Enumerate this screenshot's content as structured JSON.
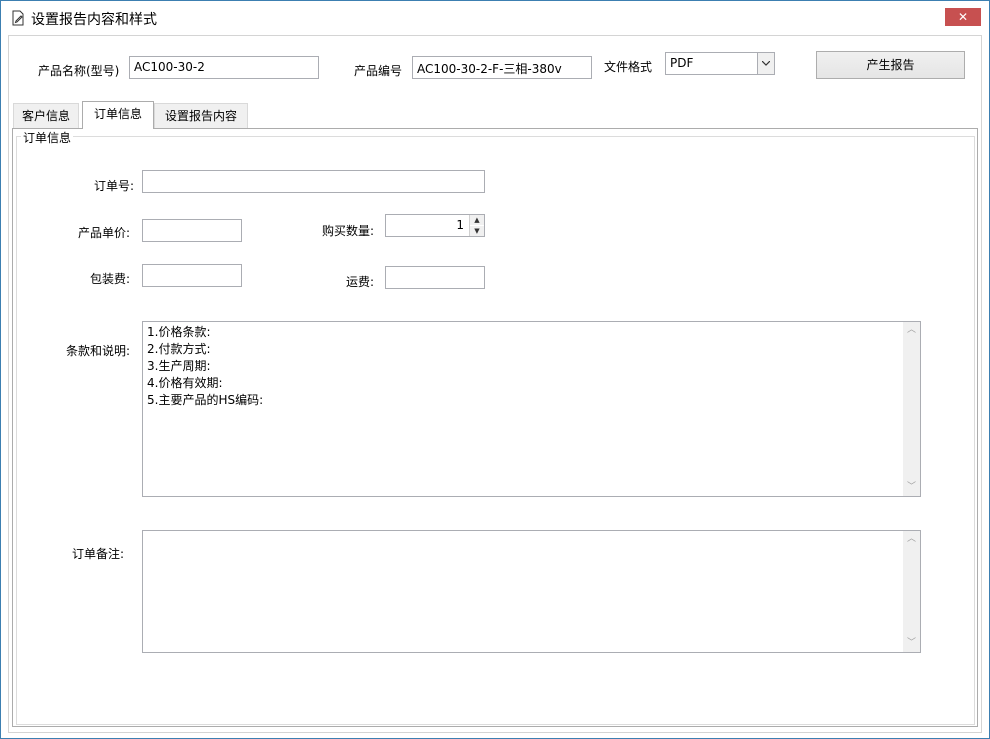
{
  "window": {
    "title": "设置报告内容和样式",
    "close_label": "✕"
  },
  "header": {
    "product_name_label": "产品名称(型号)",
    "product_name_value": "AC100-30-2",
    "product_code_label": "产品编号",
    "product_code_value": "AC100-30-2-F-三相-380v",
    "file_format_label": "文件格式",
    "file_format_value": "PDF",
    "generate_button": "产生报告"
  },
  "tabs": [
    {
      "label": "客户信息",
      "active": false
    },
    {
      "label": "订单信息",
      "active": true
    },
    {
      "label": "设置报告内容",
      "active": false
    }
  ],
  "order": {
    "group_title": "订单信息",
    "order_no_label": "订单号:",
    "order_no_value": "",
    "unit_price_label": "产品单价:",
    "unit_price_value": "",
    "quantity_label": "购买数量:",
    "quantity_value": "1",
    "packing_fee_label": "包装费:",
    "packing_fee_value": "",
    "shipping_fee_label": "运费:",
    "shipping_fee_value": "",
    "terms_label": "条款和说明:",
    "terms_lines": [
      "1.价格条款:",
      "2.付款方式:",
      "3.生产周期:",
      "4.价格有效期:",
      "5.主要产品的HS编码:"
    ],
    "remarks_label": "订单备注:",
    "remarks_value": ""
  },
  "icons": {
    "title": "document-edit-icon",
    "dropdown": "chevron-down-icon",
    "scroll_up": "chevron-up-icon",
    "scroll_down": "chevron-down-icon"
  },
  "colors": {
    "close_button": "#c75050",
    "window_border": "#3c7fb1"
  }
}
